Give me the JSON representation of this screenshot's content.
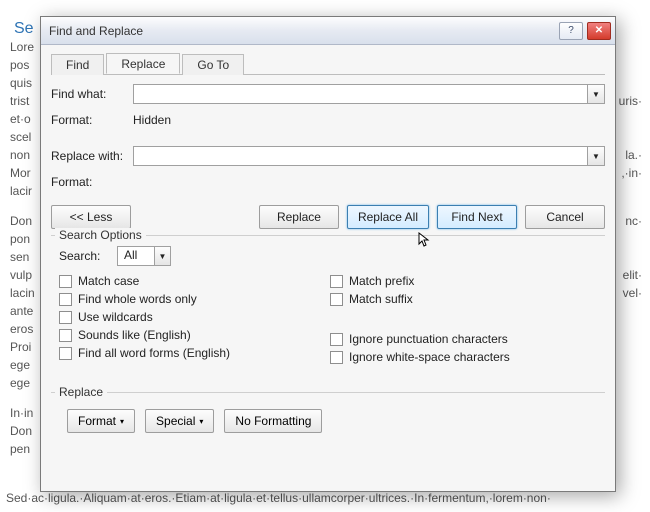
{
  "document": {
    "heading": "Se",
    "paragraphs": [
      "Lore",
      "pos",
      "quis",
      "trist",
      "et·o",
      "scel",
      "non",
      "Mor",
      "lacir",
      "",
      "Don",
      "pon",
      "sen",
      "vulp",
      "lacin",
      "ante",
      "eros",
      "Proi",
      "ege",
      "ege",
      "",
      "In·in",
      "Don",
      "pen"
    ],
    "right_paragraphs": [
      "",
      "",
      "",
      "uris·",
      "",
      "",
      "la.·",
      ",·in·",
      "",
      "",
      "nc·",
      "",
      "",
      "elit·",
      "vel·",
      "",
      "",
      "",
      "",
      "",
      "",
      "",
      "",
      ""
    ],
    "bottom_line": "Sed·ac·ligula.·Aliquam·at·eros.·Etiam·at·ligula·et·tellus·ullamcorper·ultrices.·In·fermentum,·lorem·non·"
  },
  "dialog": {
    "title": "Find and Replace",
    "tabs": {
      "find": "Find",
      "replace": "Replace",
      "goto": "Go To"
    },
    "labels": {
      "find_what": "Find what:",
      "format_find": "Format:",
      "format_find_value": "Hidden",
      "replace_with": "Replace with:",
      "format_replace": "Format:",
      "less": "<< Less",
      "replace": "Replace",
      "replace_all": "Replace All",
      "find_next": "Find Next",
      "cancel": "Cancel",
      "search_options": "Search Options",
      "search": "Search:",
      "search_value": "All",
      "match_case": "Match case",
      "whole_words": "Find whole words only",
      "use_wildcards": "Use wildcards",
      "sounds_like": "Sounds like (English)",
      "all_word_forms": "Find all word forms (English)",
      "match_prefix": "Match prefix",
      "match_suffix": "Match suffix",
      "ignore_punct": "Ignore punctuation characters",
      "ignore_white": "Ignore white-space characters",
      "replace_group": "Replace",
      "format_btn": "Format",
      "special_btn": "Special",
      "no_formatting": "No Formatting"
    },
    "values": {
      "find_what": "",
      "replace_with": ""
    }
  }
}
